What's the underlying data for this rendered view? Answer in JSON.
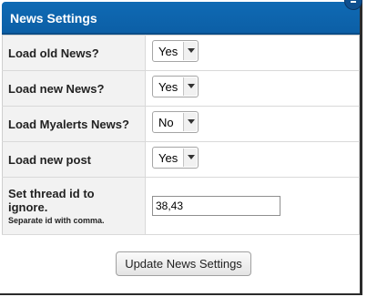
{
  "dialog": {
    "title": "News Settings"
  },
  "settings": [
    {
      "label": "Load old News?",
      "value": "Yes"
    },
    {
      "label": "Load new News?",
      "value": "Yes"
    },
    {
      "label": "Load Myalerts News?",
      "value": "No"
    },
    {
      "label": "Load new post",
      "value": "Yes"
    }
  ],
  "thread_ignore": {
    "label_line1": "Set thread id to",
    "label_line2": "ignore.",
    "sublabel": "Separate id with comma.",
    "value": "38,43"
  },
  "update_button": {
    "label": "Update News Settings"
  },
  "colors": {
    "title_bar": "#0f6ab4",
    "label_bg": "#f2f2f2"
  }
}
